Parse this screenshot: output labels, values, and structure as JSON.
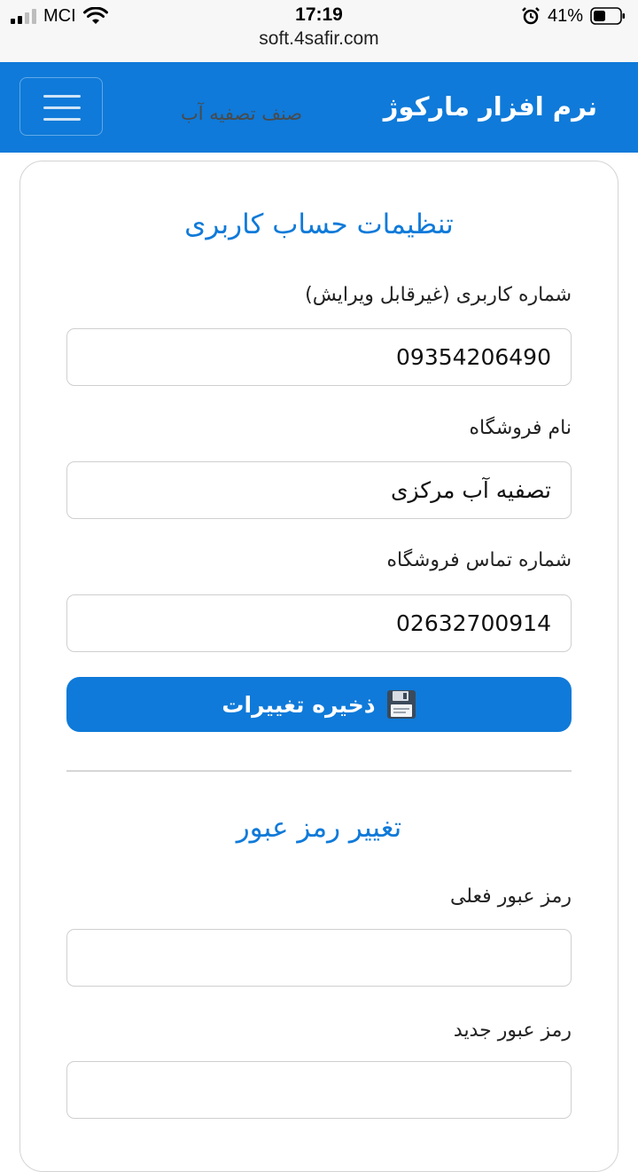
{
  "status_bar": {
    "carrier": "MCI",
    "time": "17:19",
    "battery": "41%",
    "url": "soft.4safir.com"
  },
  "navbar": {
    "brand": "نرم افزار مارکوژ",
    "subtitle": "صنف تصفیه آب",
    "menu_icon": "hamburger-menu-icon"
  },
  "account": {
    "title": "تنظیمات حساب کاربری",
    "username_label": "شماره کاربری (غیرقابل ویرایش)",
    "username_value": "09354206490",
    "shop_name_label": "نام فروشگاه",
    "shop_name_value": "تصفیه آب مرکزی",
    "shop_phone_label": "شماره تماس فروشگاه",
    "shop_phone_value": "02632700914",
    "save_label": "ذخیره تغییرات",
    "save_icon": "floppy-disk-icon"
  },
  "password": {
    "title": "تغییر رمز عبور",
    "current_label": "رمز عبور فعلی",
    "current_value": "",
    "new_label": "رمز عبور جدید",
    "new_value": ""
  },
  "colors": {
    "primary": "#0f7ad9"
  }
}
